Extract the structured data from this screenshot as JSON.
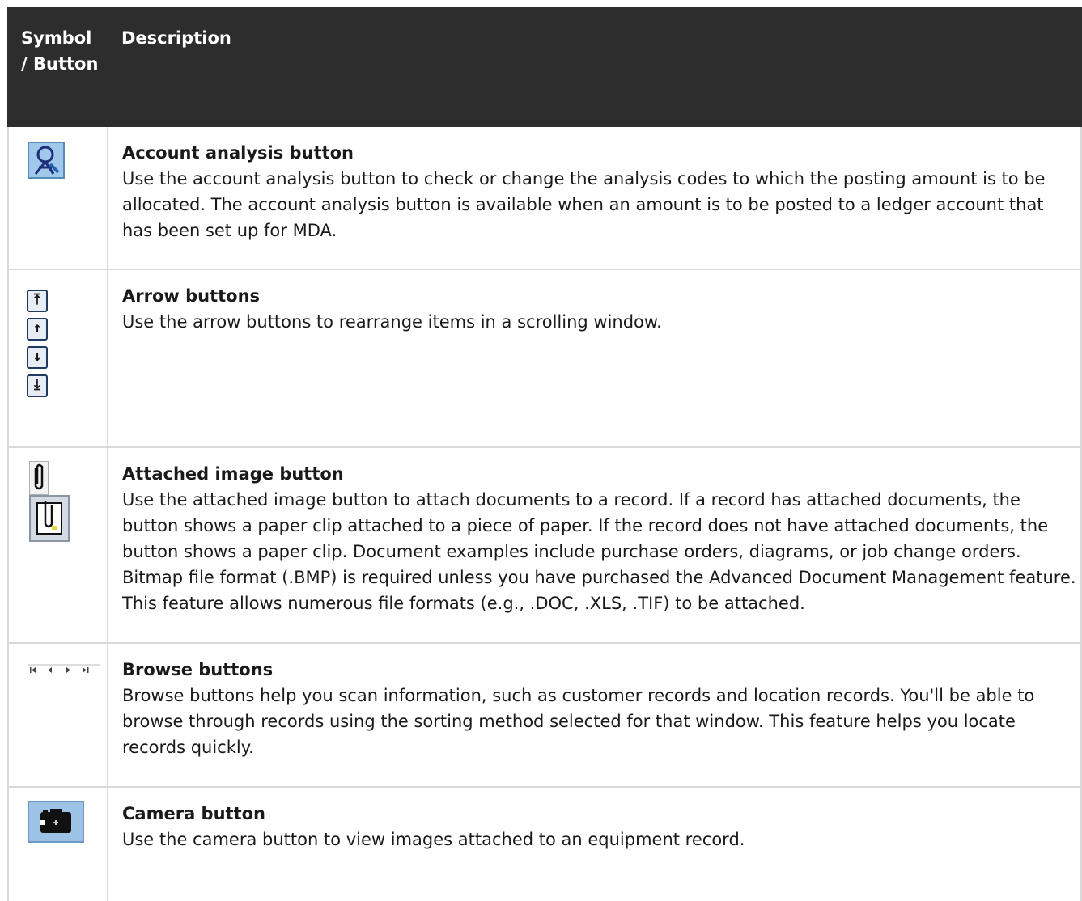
{
  "header": {
    "symbol_col": "Symbol / Button",
    "description_col": "Description"
  },
  "rows": [
    {
      "title": "Account analysis button",
      "body": "Use the account analysis button to check or change the analysis codes to which the posting amount is to be allocated. The account analysis button is available when an amount is to be posted to a ledger account that has been set up for MDA.",
      "icon": "account-analysis-icon"
    },
    {
      "title": "Arrow buttons",
      "body": "Use the arrow buttons to rearrange items in a scrolling window.",
      "icon": "arrow-buttons-icon"
    },
    {
      "title": "Attached image button",
      "body": "Use the attached image button to attach documents to a record. If a record has attached documents, the button shows a paper clip attached to a piece of paper. If the record does not have attached documents, the button shows a paper clip. Document examples include purchase orders, diagrams, or job change orders. Bitmap file format (.BMP) is required unless you have purchased the Advanced Document Management feature. This feature allows numerous file formats (e.g., .DOC, .XLS, .TIF) to be attached.",
      "icon": "paperclip-icon"
    },
    {
      "title": "Browse buttons",
      "body": "Browse buttons help you scan information, such as customer records and location records. You'll be able to browse through records using the sorting method selected for that window. This feature helps you locate records quickly.",
      "icon": "browse-buttons-icon"
    },
    {
      "title": "Camera button",
      "body": "Use the camera button to view images attached to an equipment record.",
      "icon": "camera-icon"
    }
  ]
}
